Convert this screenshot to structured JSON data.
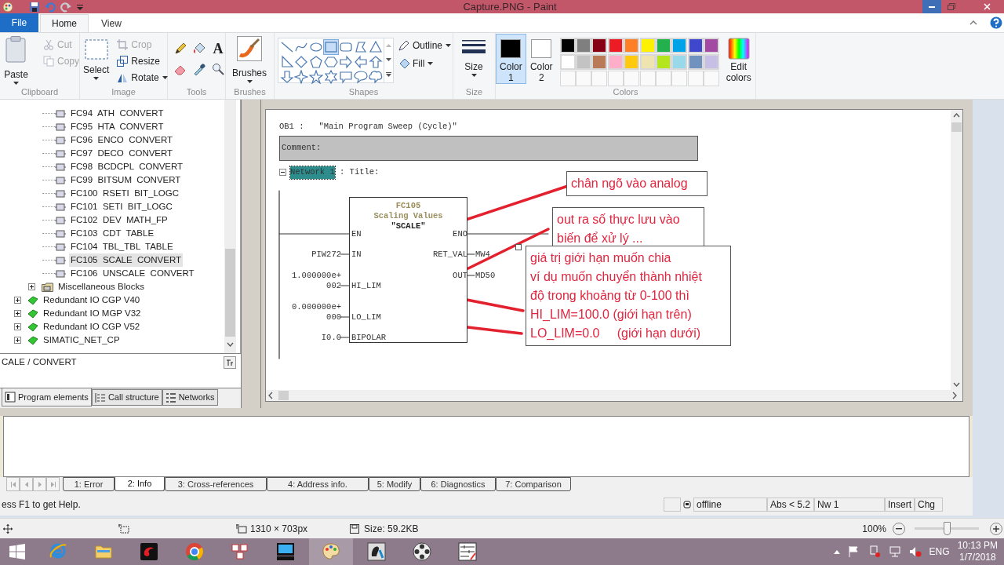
{
  "window": {
    "title": "Capture.PNG - Paint"
  },
  "ribbon_tabs": [
    {
      "label": "File",
      "kind": "file",
      "selected": false
    },
    {
      "label": "Home",
      "kind": "tab",
      "selected": true
    },
    {
      "label": "View",
      "kind": "tab",
      "selected": false
    }
  ],
  "clipboard": {
    "label": "Clipboard",
    "paste": "Paste",
    "items": [
      {
        "label": "Cut",
        "kind": "cut",
        "disabled": true
      },
      {
        "label": "Copy",
        "kind": "copy",
        "disabled": true
      }
    ]
  },
  "image": {
    "label": "Image",
    "select": "Select",
    "items": [
      {
        "label": "Crop",
        "kind": "crop",
        "disabled": true
      },
      {
        "label": "Resize",
        "kind": "resize",
        "disabled": false
      },
      {
        "label": "Rotate",
        "kind": "rotate",
        "disabled": false
      }
    ]
  },
  "tools": {
    "label": "Tools",
    "text_tool": "A"
  },
  "brushes": {
    "label": "Brushes",
    "button": "Brushes"
  },
  "shapes": {
    "label": "Shapes",
    "outline": "Outline",
    "fill": "Fill",
    "items": [
      {
        "kind": "line",
        "selected": false
      },
      {
        "kind": "curve",
        "selected": false
      },
      {
        "kind": "oval",
        "selected": false
      },
      {
        "kind": "rectangle",
        "selected": true
      },
      {
        "kind": "rounded_rectangle",
        "selected": false
      },
      {
        "kind": "polygon",
        "selected": false
      },
      {
        "kind": "triangle",
        "selected": false
      },
      {
        "kind": "right_triangle",
        "selected": false
      },
      {
        "kind": "diamond",
        "selected": false
      },
      {
        "kind": "pentagon",
        "selected": false
      },
      {
        "kind": "hexagon",
        "selected": false
      },
      {
        "kind": "arrow_right",
        "selected": false
      },
      {
        "kind": "arrow_left",
        "selected": false
      },
      {
        "kind": "arrow_up",
        "selected": false
      },
      {
        "kind": "arrow_down",
        "selected": false
      },
      {
        "kind": "star4",
        "selected": false
      },
      {
        "kind": "star5",
        "selected": false
      },
      {
        "kind": "star6",
        "selected": false
      },
      {
        "kind": "callout_rect",
        "selected": false
      },
      {
        "kind": "callout_oval",
        "selected": false
      },
      {
        "kind": "callout_cloud",
        "selected": false
      }
    ]
  },
  "size": {
    "label": "Size",
    "button": "Size"
  },
  "colors": {
    "label": "Colors",
    "edit": "Edit colors",
    "color_1": {
      "label": "Color 1",
      "color": "#000000",
      "selected": true
    },
    "color_2": {
      "label": "Color 2",
      "color": "#ffffff",
      "selected": false
    },
    "palette": [
      {
        "kind": "color",
        "color": "#000000"
      },
      {
        "kind": "color",
        "color": "#7f7f7f"
      },
      {
        "kind": "color",
        "color": "#880015"
      },
      {
        "kind": "color",
        "color": "#ed1c24"
      },
      {
        "kind": "color",
        "color": "#ff7f27"
      },
      {
        "kind": "color",
        "color": "#fff200"
      },
      {
        "kind": "color",
        "color": "#22b14c"
      },
      {
        "kind": "color",
        "color": "#00a2e8"
      },
      {
        "kind": "color",
        "color": "#3f48cc"
      },
      {
        "kind": "color",
        "color": "#a349a4"
      },
      {
        "kind": "color",
        "color": "#ffffff"
      },
      {
        "kind": "color",
        "color": "#c3c3c3"
      },
      {
        "kind": "color",
        "color": "#b97a57"
      },
      {
        "kind": "color",
        "color": "#ffaec9"
      },
      {
        "kind": "color",
        "color": "#ffc90e"
      },
      {
        "kind": "color",
        "color": "#efe4b0"
      },
      {
        "kind": "color",
        "color": "#b5e61d"
      },
      {
        "kind": "color",
        "color": "#99d9ea"
      },
      {
        "kind": "color",
        "color": "#7092be"
      },
      {
        "kind": "color",
        "color": "#c8bfe7"
      },
      {
        "kind": "empty"
      },
      {
        "kind": "empty"
      },
      {
        "kind": "empty"
      },
      {
        "kind": "empty"
      },
      {
        "kind": "empty"
      },
      {
        "kind": "empty"
      },
      {
        "kind": "empty"
      },
      {
        "kind": "empty"
      },
      {
        "kind": "empty"
      },
      {
        "kind": "empty"
      }
    ]
  },
  "step7": {
    "tree": [
      {
        "children": [
          {
            "children": [
              {
                "label": "FC94  ATH  CONVERT",
                "kind": "block",
                "selected": false
              },
              {
                "label": "FC95  HTA  CONVERT",
                "kind": "block",
                "selected": false
              },
              {
                "label": "FC96  ENCO  CONVERT",
                "kind": "block",
                "selected": false
              },
              {
                "label": "FC97  DECO  CONVERT",
                "kind": "block",
                "selected": false
              },
              {
                "label": "FC98  BCDCPL  CONVERT",
                "kind": "block",
                "selected": false
              },
              {
                "label": "FC99  BITSUM  CONVERT",
                "kind": "block",
                "selected": false
              },
              {
                "label": "FC100  RSETI  BIT_LOGC",
                "kind": "block",
                "selected": false
              },
              {
                "label": "FC101  SETI  BIT_LOGC",
                "kind": "block",
                "selected": false
              },
              {
                "label": "FC102  DEV  MATH_FP",
                "kind": "block",
                "selected": false
              },
              {
                "label": "FC103  CDT  TABLE",
                "kind": "block",
                "selected": false
              },
              {
                "label": "FC104  TBL_TBL  TABLE",
                "kind": "block",
                "selected": false
              },
              {
                "label": "FC105  SCALE  CONVERT",
                "kind": "block",
                "selected": true
              },
              {
                "label": "FC106  UNSCALE  CONVERT",
                "kind": "block",
                "selected": false
              }
            ]
          },
          {
            "label": "Miscellaneous Blocks",
            "kind": "folder",
            "expanded": false,
            "selected": false
          }
        ]
      },
      {
        "label": "Redundant IO CGP V40",
        "kind": "library",
        "expanded": false,
        "selected": false
      },
      {
        "label": "Redundant IO MGP V32",
        "kind": "library",
        "expanded": false,
        "selected": false
      },
      {
        "label": "Redundant IO CGP V52",
        "kind": "library",
        "expanded": false,
        "selected": false
      },
      {
        "label": "SIMATIC_NET_CP",
        "kind": "library",
        "expanded": false,
        "selected": false
      }
    ],
    "tree_status": "CALE / CONVERT",
    "panel_tabs": [
      {
        "label": "Program elements",
        "kind": "elements",
        "selected": true
      },
      {
        "label": "Call structure",
        "kind": "calls",
        "selected": false
      },
      {
        "label": "Networks",
        "kind": "networks",
        "selected": false
      }
    ],
    "block_title": "OB1 :   \"Main Program Sweep (Cycle)\"",
    "comment": "Comment:",
    "network": {
      "label": "Network 1",
      "selected": true,
      "expanded": true,
      "title": ": Title:"
    },
    "block": {
      "number": "FC105",
      "description": "Scaling Values",
      "name": "\"SCALE\"",
      "inputs": [
        {
          "pin": "EN",
          "kind": "rail"
        },
        {
          "pin": "IN",
          "kind": "operand",
          "operand": [
            "PIW272"
          ]
        },
        {
          "pin": "HI_LIM",
          "kind": "operand",
          "operand": [
            "1.000000e+",
            "002"
          ]
        },
        {
          "pin": "LO_LIM",
          "kind": "operand",
          "operand": [
            "0.000000e+",
            "000"
          ]
        },
        {
          "pin": "BIPOLAR",
          "kind": "operand",
          "operand": [
            "I0.0"
          ]
        }
      ],
      "outputs": [
        {
          "pin": "ENO",
          "kind": "rail"
        },
        {
          "pin": "RET_VAL",
          "kind": "operand",
          "operand": [
            "MW4"
          ]
        },
        {
          "pin": "OUT",
          "kind": "operand",
          "operand": [
            "MD50"
          ]
        }
      ]
    },
    "annotations": [
      {
        "lines": [
          "chân ngõ vào analog"
        ]
      },
      {
        "lines": [
          "out ra số thực lưu vào",
          "biến để xử lý ..."
        ]
      },
      {
        "lines": [
          "giá trị giới hạn muốn chia",
          "ví dụ muốn chuyển thành nhiệt",
          "độ trong khoảng từ 0-100 thì",
          "HI_LIM=100.0 (giới hạn trên)",
          "LO_LIM=0.0     (giới hạn dưới)"
        ]
      }
    ],
    "output_tabs": [
      {
        "label": "1: Error",
        "selected": false
      },
      {
        "label": "2: Info",
        "selected": true
      },
      {
        "label": "3: Cross-references",
        "selected": false
      },
      {
        "label": "4: Address info.",
        "selected": false
      },
      {
        "label": "5: Modify",
        "selected": false
      },
      {
        "label": "6: Diagnostics",
        "selected": false
      },
      {
        "label": "7: Comparison",
        "selected": false
      }
    ],
    "status_bar": {
      "help": "ess F1 to get Help.",
      "mode": "offline",
      "fields": [
        "Abs < 5.2",
        "Nw 1",
        "Insert",
        "Chg"
      ]
    }
  },
  "paint_status": {
    "dimensions": "1310 × 703px",
    "size": "Size: 59.2KB",
    "zoom": "100%",
    "zoom_slider": {
      "level": 0.5
    }
  },
  "taskbar": {
    "apps": [
      {
        "kind": "ie",
        "selected": false
      },
      {
        "kind": "explorer",
        "selected": false
      },
      {
        "kind": "dragon",
        "selected": false
      },
      {
        "kind": "chrome",
        "selected": false
      },
      {
        "kind": "tiles",
        "selected": false
      },
      {
        "kind": "monitor",
        "selected": false
      },
      {
        "kind": "paint",
        "selected": true
      },
      {
        "kind": "foot",
        "selected": false
      },
      {
        "kind": "reel",
        "selected": false
      },
      {
        "kind": "ladder",
        "selected": false
      }
    ],
    "language": "ENG",
    "time": "10:13 PM",
    "date": "1/7/2018"
  }
}
